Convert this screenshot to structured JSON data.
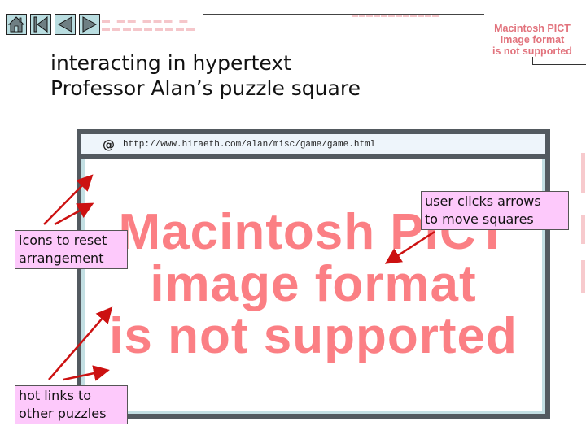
{
  "nav": {
    "buttons": [
      {
        "name": "home",
        "icon": "home-icon"
      },
      {
        "name": "first",
        "icon": "first-page-icon"
      },
      {
        "name": "previous",
        "icon": "previous-icon"
      },
      {
        "name": "next",
        "icon": "next-icon"
      }
    ]
  },
  "placeholder": {
    "small_lines": [
      "Macintosh PICT",
      "Image format",
      "is not supported"
    ],
    "big_lines": [
      "Macintosh PICT",
      "image format",
      "is not supported"
    ]
  },
  "title": {
    "line1": "interacting in hypertext",
    "line2": "Professor Alan’s puzzle square"
  },
  "browser": {
    "url_icon": "@",
    "url": "http://www.hiraeth.com/alan/misc/game/game.html"
  },
  "callouts": {
    "reset": {
      "line1": "icons to reset",
      "line2": "arrangement"
    },
    "arrows": {
      "line1": "user clicks arrows",
      "line2": "to move squares"
    },
    "links": {
      "line1": "hot links to",
      "line2": "other puzzles"
    }
  },
  "colors": {
    "arrow": "#cc1111",
    "callout_bg": "#fdc9fb",
    "pict_red": "#fb7f84",
    "nav_button": "#b9dde0",
    "browser_frame": "#535a60"
  }
}
